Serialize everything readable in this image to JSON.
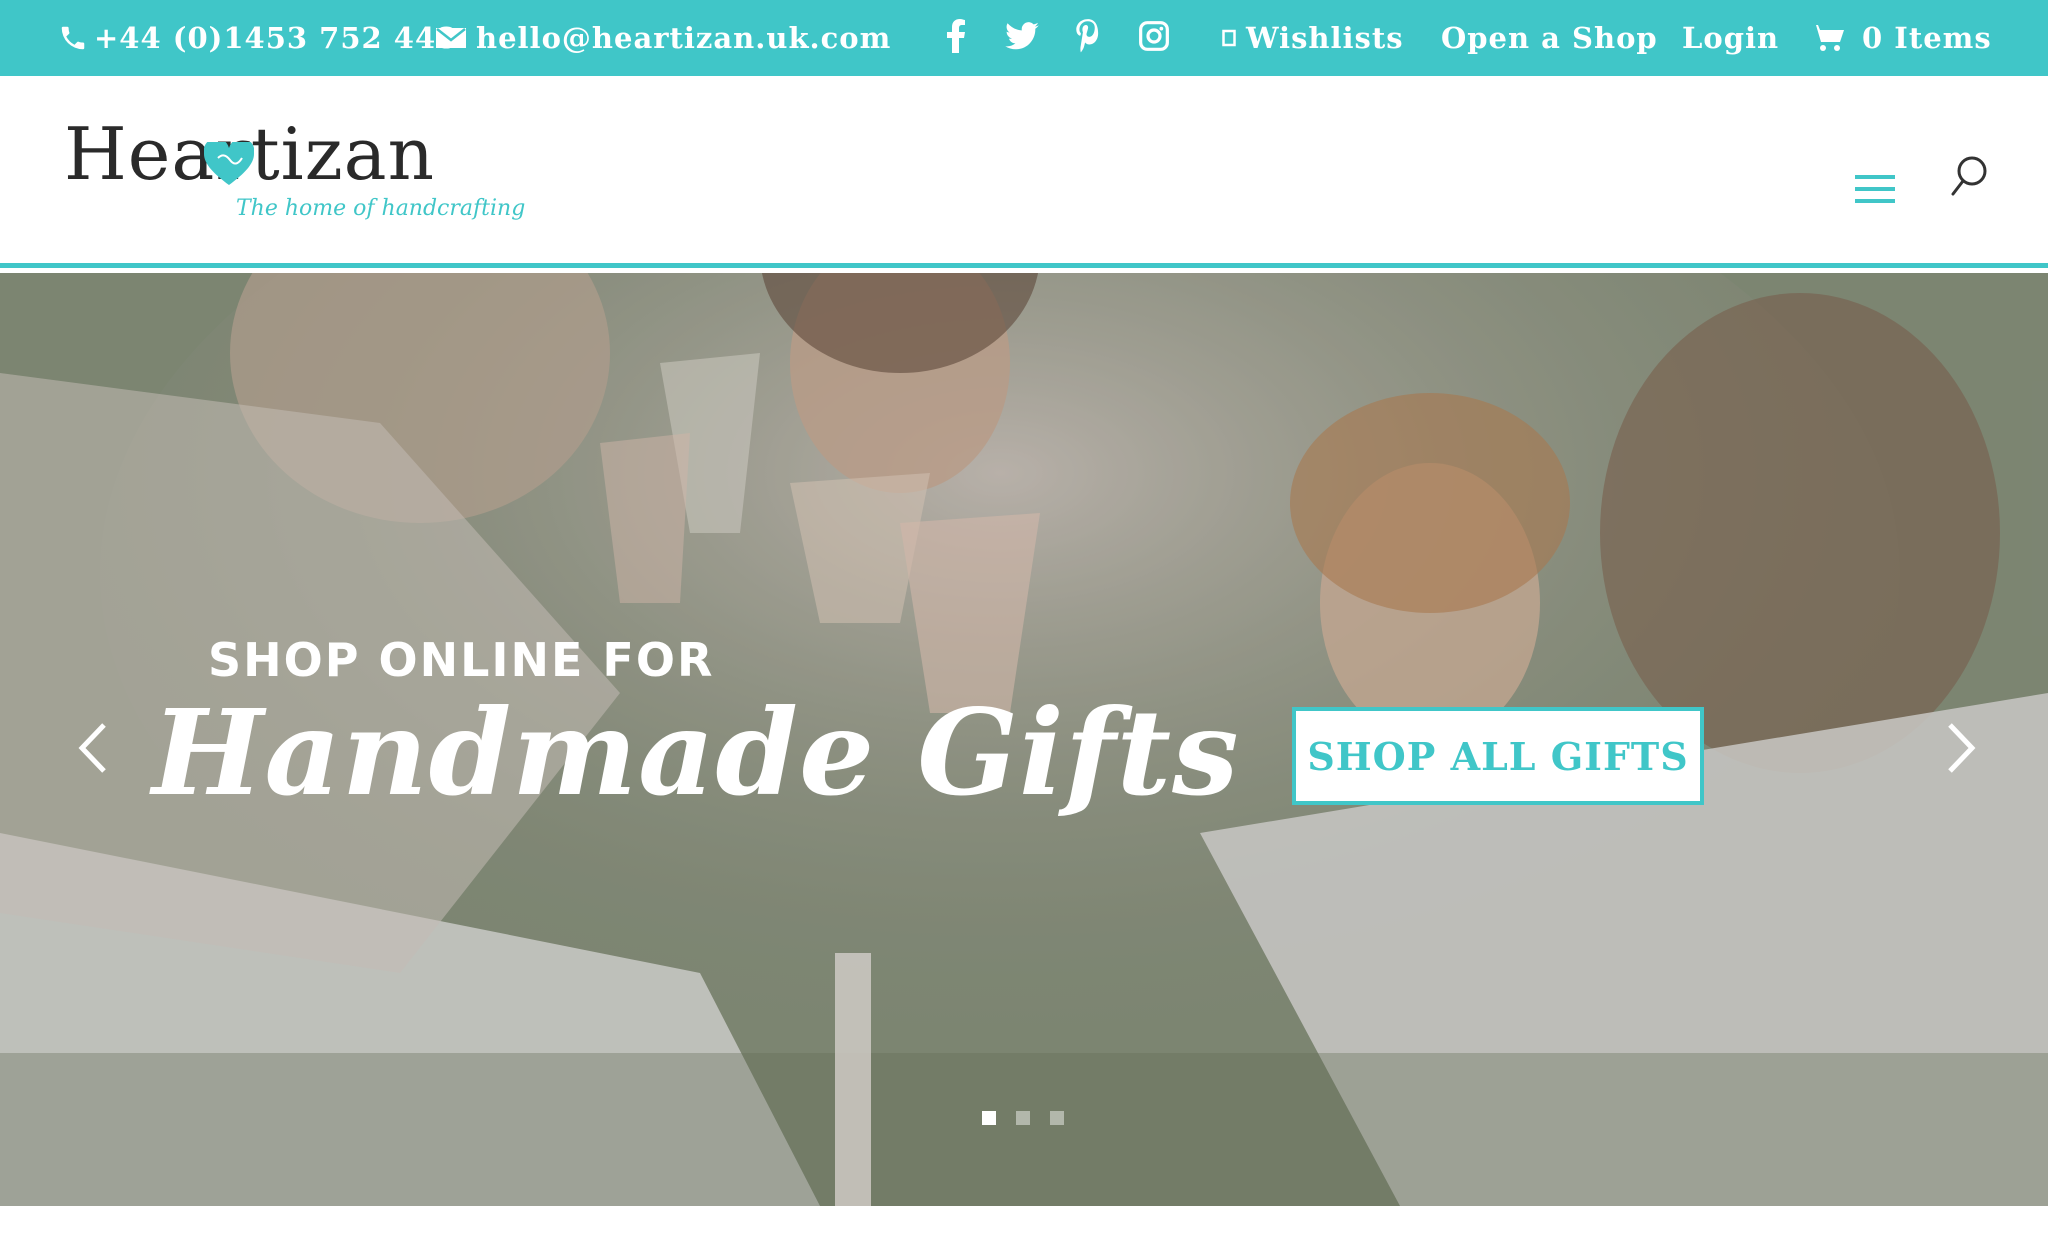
{
  "topbar": {
    "phone": "+44 (0)1453 752 448",
    "email": "hello@heartizan.uk.com",
    "social_icons": [
      "facebook-icon",
      "twitter-icon",
      "pinterest-icon",
      "instagram-icon"
    ],
    "wishlists": "Wishlists",
    "open_shop": "Open a Shop",
    "login": "Login",
    "cart": "0 Items"
  },
  "header": {
    "logo_text": "Heartizan",
    "logo_tagline": "The home of handcrafting"
  },
  "hero": {
    "eyebrow": "SHOP ONLINE FOR",
    "title": "Handmade Gifts",
    "cta": "SHOP ALL GIFTS",
    "slide_count": 3,
    "active_slide": 1
  },
  "colors": {
    "accent": "#40c6c8",
    "text_dark": "#2a2a2a",
    "white": "#ffffff"
  }
}
